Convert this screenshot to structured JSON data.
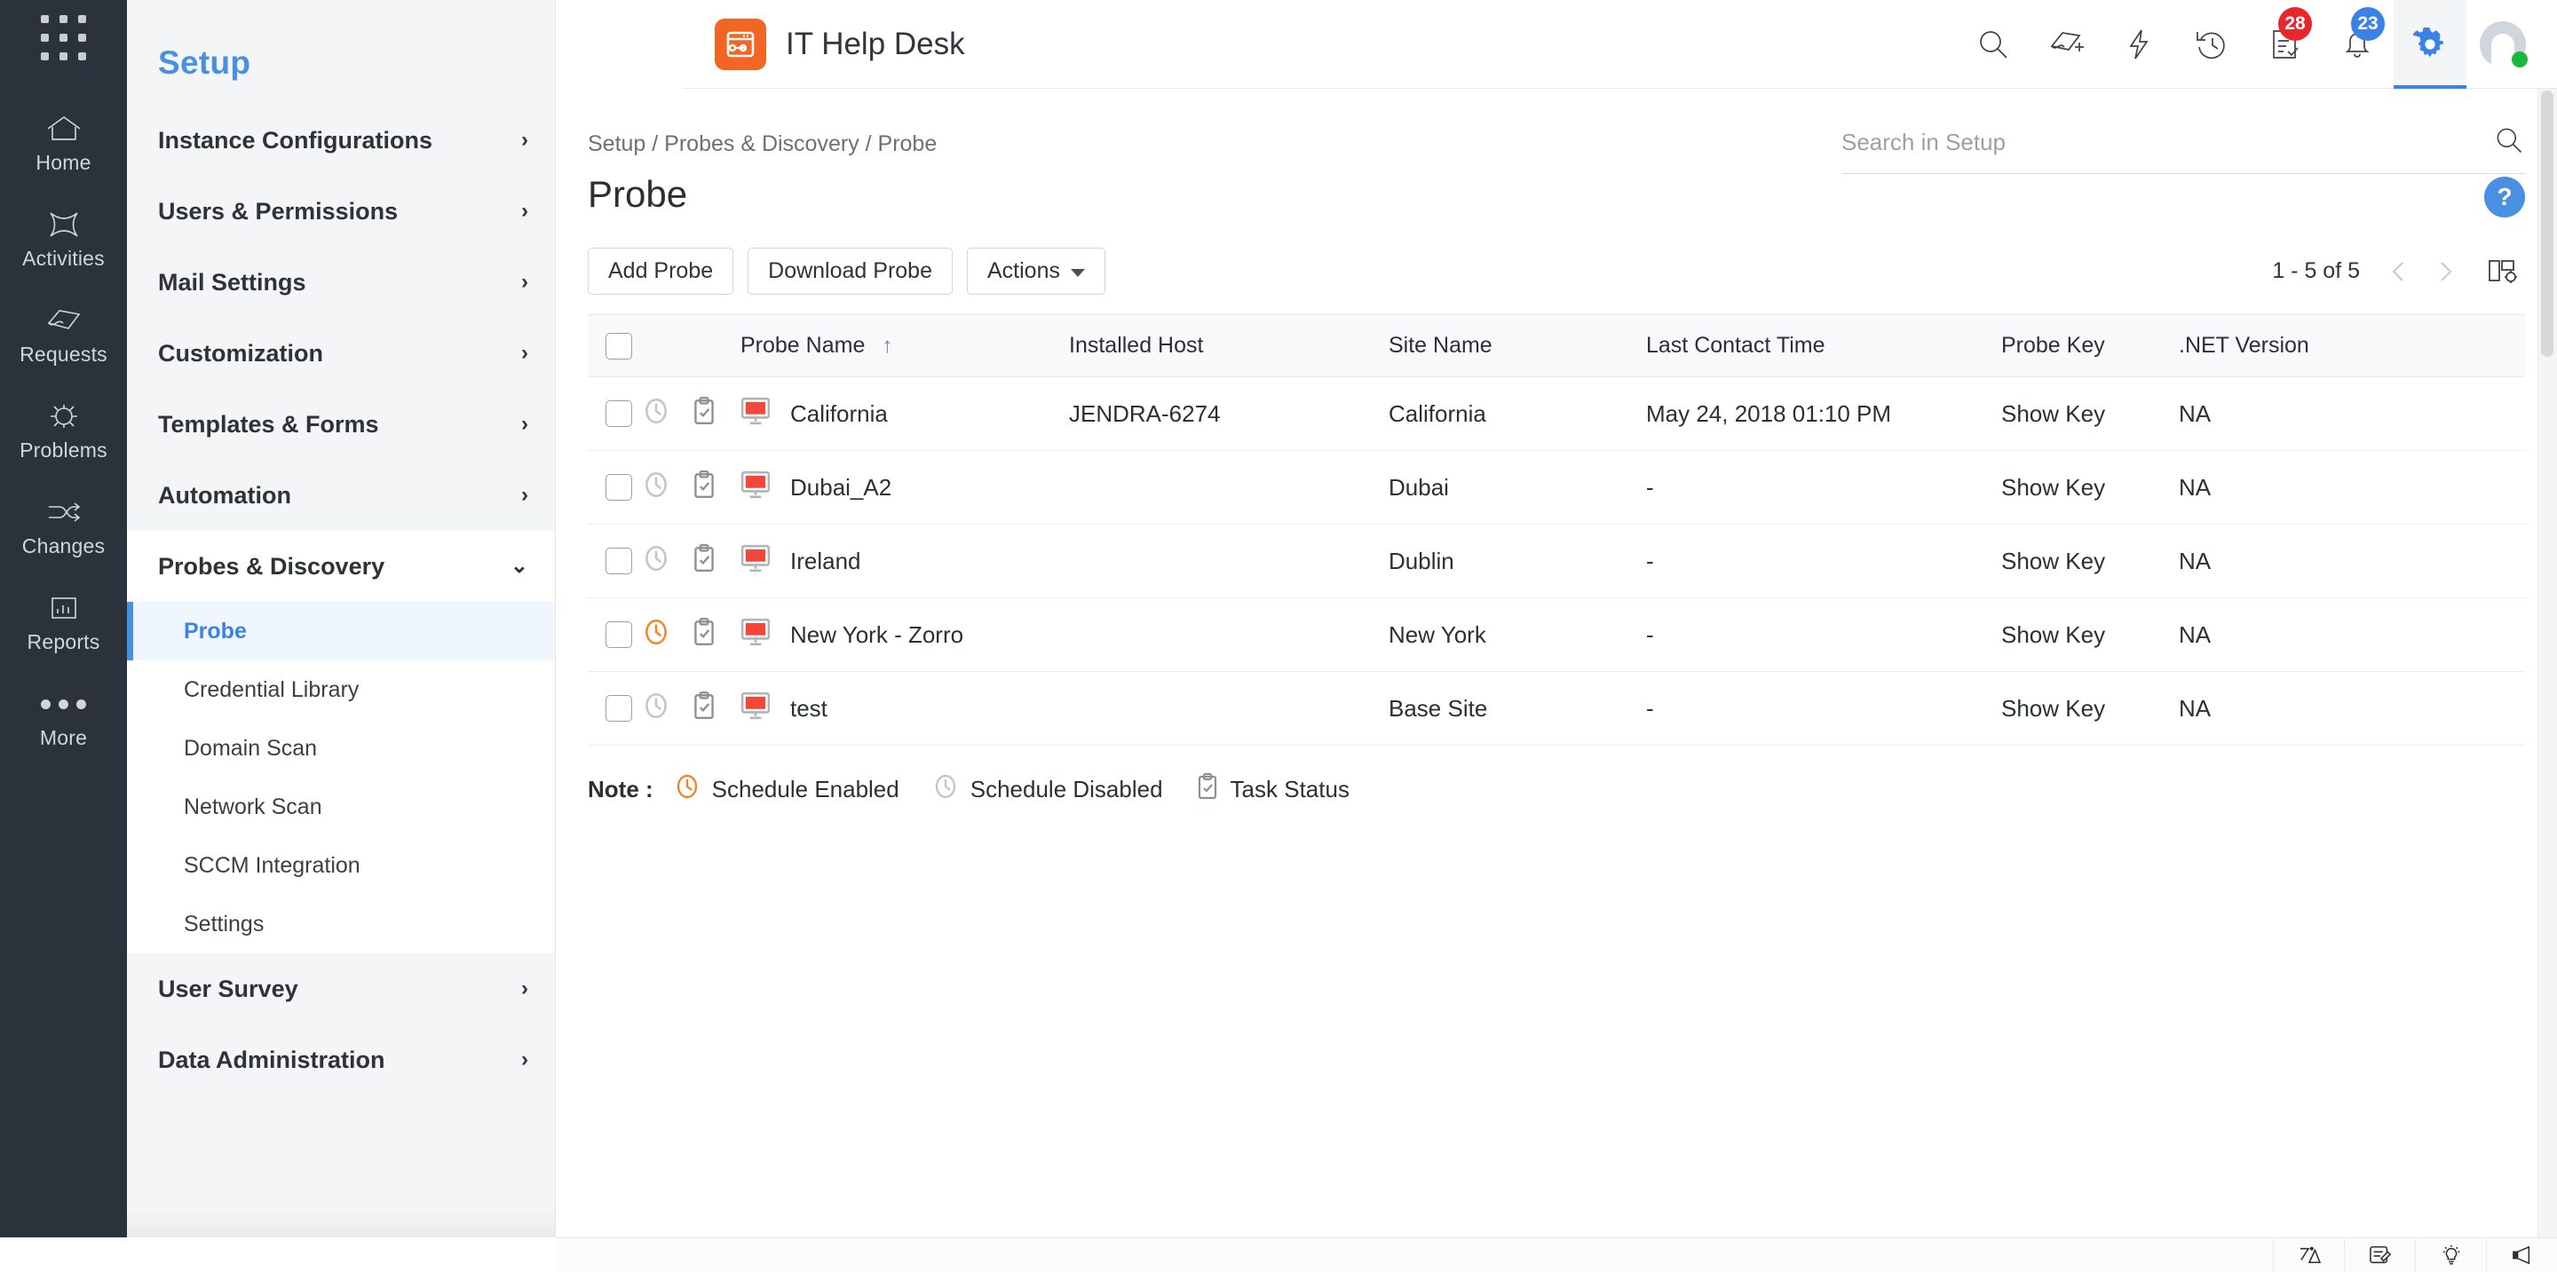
{
  "header": {
    "app_title": "IT Help Desk",
    "logo_icon": "wrench-window-icon",
    "apps_grid_icon": "apps-grid-icon",
    "icons": [
      {
        "name": "search-icon",
        "label": "Search"
      },
      {
        "name": "add-request-icon",
        "label": "New Request"
      },
      {
        "name": "quick-actions-icon",
        "label": "Quick Actions"
      },
      {
        "name": "history-icon",
        "label": "Recent Items"
      },
      {
        "name": "approvals-icon",
        "label": "Approvals",
        "badge": "28",
        "badge_color": "#e8272c"
      },
      {
        "name": "notifications-bell-icon",
        "label": "Notifications",
        "badge": "23",
        "badge_color": "#3b82e8"
      },
      {
        "name": "gear-icon",
        "label": "Setup",
        "selected": true
      }
    ],
    "avatar": {
      "name": "avatar",
      "status": "online"
    }
  },
  "rail": {
    "items": [
      {
        "label": "Home",
        "icon": "home-icon"
      },
      {
        "label": "Activities",
        "icon": "activities-icon"
      },
      {
        "label": "Requests",
        "icon": "requests-icon"
      },
      {
        "label": "Problems",
        "icon": "problems-icon"
      },
      {
        "label": "Changes",
        "icon": "changes-icon"
      },
      {
        "label": "Reports",
        "icon": "reports-icon"
      },
      {
        "label": "More",
        "icon": "more-dots-icon"
      }
    ]
  },
  "setup_sidebar": {
    "title": "Setup",
    "items": [
      {
        "label": "Instance Configurations",
        "expandable": true,
        "expanded": false
      },
      {
        "label": "Users & Permissions",
        "expandable": true,
        "expanded": false
      },
      {
        "label": "Mail Settings",
        "expandable": true,
        "expanded": false
      },
      {
        "label": "Customization",
        "expandable": true,
        "expanded": false
      },
      {
        "label": "Templates & Forms",
        "expandable": true,
        "expanded": false
      },
      {
        "label": "Automation",
        "expandable": true,
        "expanded": false
      }
    ],
    "expanded_group": {
      "label": "Probes & Discovery",
      "expanded": true,
      "children": [
        {
          "label": "Probe",
          "active": true
        },
        {
          "label": "Credential Library",
          "active": false
        },
        {
          "label": "Domain Scan",
          "active": false
        },
        {
          "label": "Network Scan",
          "active": false
        },
        {
          "label": "SCCM Integration",
          "active": false
        },
        {
          "label": "Settings",
          "active": false
        }
      ]
    },
    "items_after": [
      {
        "label": "User Survey",
        "expandable": true,
        "expanded": false
      },
      {
        "label": "Data Administration",
        "expandable": true,
        "expanded": false
      }
    ]
  },
  "breadcrumb": "Setup / Probes & Discovery / Probe",
  "page_title": "Probe",
  "help_button_label": "?",
  "setup_search": {
    "placeholder": "Search in Setup",
    "value": "",
    "icon": "search-icon"
  },
  "toolbar": {
    "add_probe_label": "Add Probe",
    "download_probe_label": "Download Probe",
    "actions_label": "Actions",
    "pagination_text": "1 - 5 of 5",
    "prev_icon": "chevron-left-icon",
    "next_icon": "chevron-right-icon",
    "column_settings_icon": "column-settings-icon"
  },
  "table": {
    "columns": [
      {
        "key": "checkbox",
        "label": ""
      },
      {
        "key": "schedule",
        "label": ""
      },
      {
        "key": "task",
        "label": ""
      },
      {
        "key": "probe_name",
        "label": "Probe Name",
        "sorted": "asc"
      },
      {
        "key": "installed_host",
        "label": "Installed Host"
      },
      {
        "key": "site_name",
        "label": "Site Name"
      },
      {
        "key": "last_contact_time",
        "label": "Last Contact Time"
      },
      {
        "key": "probe_key",
        "label": "Probe Key"
      },
      {
        "key": "net_version",
        "label": ".NET Version"
      }
    ],
    "select_all_checked": false,
    "rows": [
      {
        "checked": false,
        "schedule_enabled": false,
        "probe_name": "California",
        "installed_host": "JENDRA-6274",
        "site_name": "California",
        "last_contact_time": "May 24, 2018 01:10 PM",
        "probe_key": "Show Key",
        "net_version": "NA"
      },
      {
        "checked": false,
        "schedule_enabled": false,
        "probe_name": "Dubai_A2",
        "installed_host": "",
        "site_name": "Dubai",
        "last_contact_time": "-",
        "probe_key": "Show Key",
        "net_version": "NA"
      },
      {
        "checked": false,
        "schedule_enabled": false,
        "probe_name": "Ireland",
        "installed_host": "",
        "site_name": "Dublin",
        "last_contact_time": "-",
        "probe_key": "Show Key",
        "net_version": "NA"
      },
      {
        "checked": false,
        "schedule_enabled": true,
        "probe_name": "New York - Zorro",
        "installed_host": "",
        "site_name": "New York",
        "last_contact_time": "-",
        "probe_key": "Show Key",
        "net_version": "NA"
      },
      {
        "checked": false,
        "schedule_enabled": false,
        "probe_name": "test",
        "installed_host": "",
        "site_name": "Base Site",
        "last_contact_time": "-",
        "probe_key": "Show Key",
        "net_version": "NA"
      }
    ]
  },
  "note": {
    "label": "Note :",
    "legend": [
      {
        "icon": "clock-enabled-icon",
        "label": "Schedule Enabled",
        "color": "#f4862a"
      },
      {
        "icon": "clock-disabled-icon",
        "label": "Schedule Disabled",
        "color": "#bfc3c7"
      },
      {
        "icon": "task-status-icon",
        "label": "Task Status",
        "color": "#8b9096"
      }
    ]
  },
  "footer": {
    "icons": [
      {
        "name": "annotate-icon"
      },
      {
        "name": "feedback-edit-icon"
      },
      {
        "name": "idea-bulb-icon"
      },
      {
        "name": "announcement-megaphone-icon"
      }
    ]
  },
  "colors": {
    "brand_orange": "#f26522",
    "accent_blue": "#3b82e8",
    "rail_dark": "#2b323b",
    "probe_red": "#f4473b",
    "schedule_enabled": "#f4862a"
  }
}
